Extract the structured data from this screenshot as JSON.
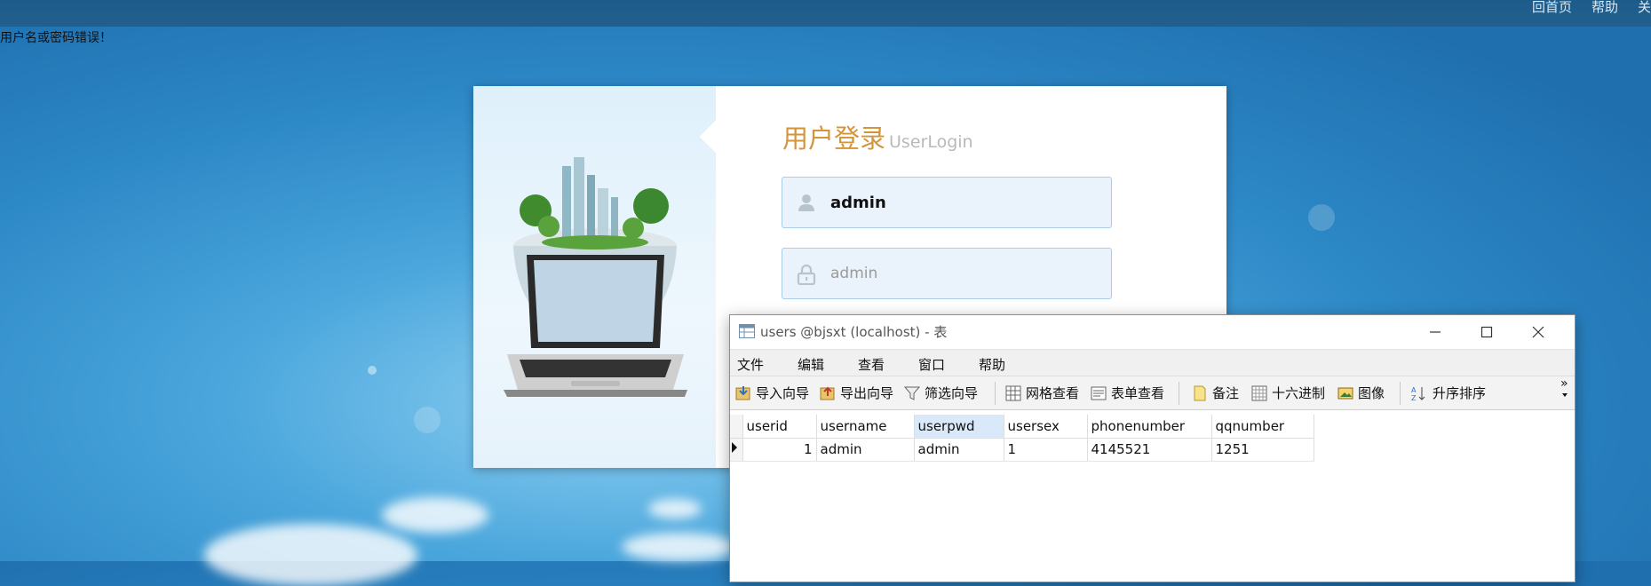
{
  "top_nav": {
    "items": [
      "回首页",
      "帮助",
      "关"
    ]
  },
  "error_message": "用户名或密码错误！",
  "login": {
    "title_cn": "用户登录",
    "title_en": "UserLogin",
    "username_value": "admin",
    "password_placeholder": "admin"
  },
  "navicat_window": {
    "title": "users @bjsxt (localhost) - 表",
    "menu": [
      "文件",
      "编辑",
      "查看",
      "窗口",
      "帮助"
    ],
    "toolbar": {
      "import_wizard": "导入向导",
      "export_wizard": "导出向导",
      "filter_wizard": "筛选向导",
      "grid_view": "网格查看",
      "form_view": "表单查看",
      "memo": "备注",
      "hex": "十六进制",
      "image": "图像",
      "sort_asc": "升序排序",
      "more": "»"
    },
    "table": {
      "columns": [
        "userid",
        "username",
        "userpwd",
        "usersex",
        "phonenumber",
        "qqnumber"
      ],
      "selected_column": "userpwd",
      "rows": [
        [
          "1",
          "admin",
          "admin",
          "1",
          "4145521",
          "1251"
        ]
      ]
    }
  },
  "colors": {
    "title_accent": "#d4943a",
    "background_blue": "#2d88c6",
    "topbar": "#1c5c8b"
  }
}
